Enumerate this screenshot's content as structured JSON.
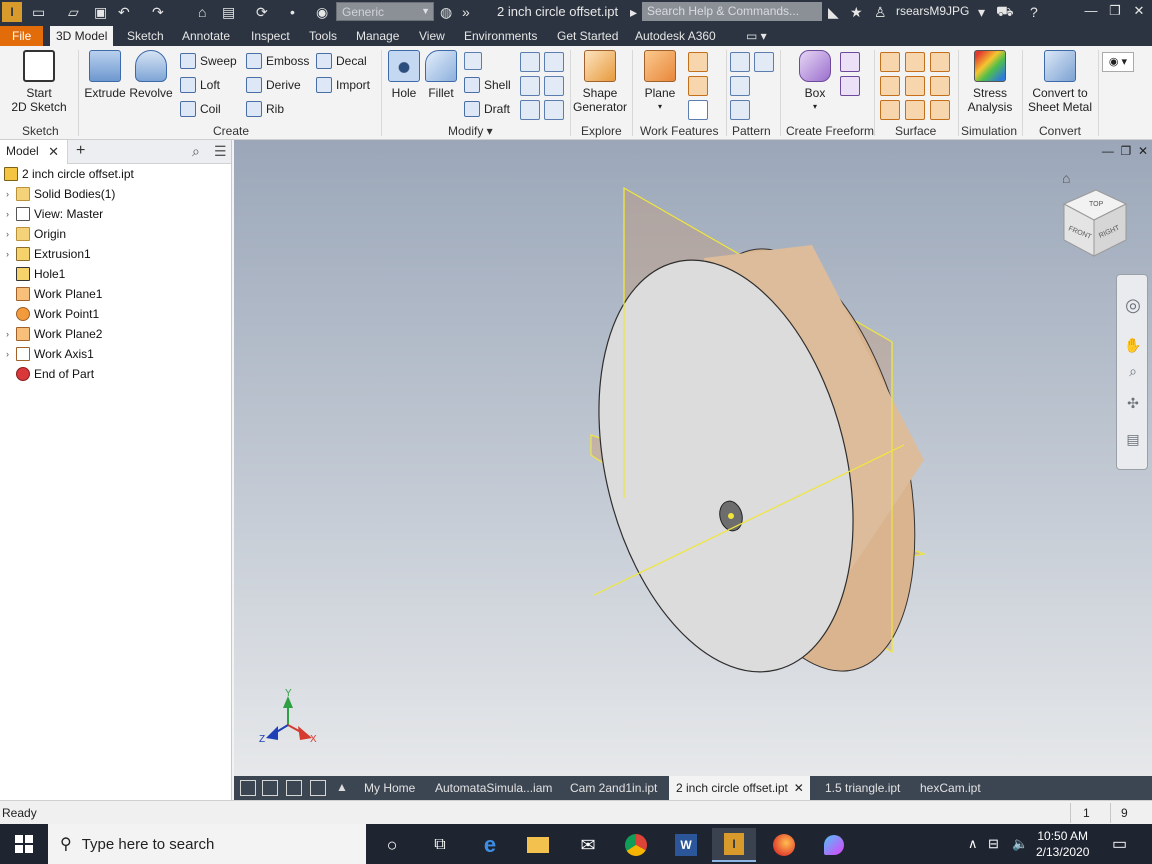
{
  "titlebar": {
    "material": "Generic",
    "document_title": "2 inch circle offset.ipt",
    "search_placeholder": "Search Help & Commands...",
    "user": "rsearsM9JPG"
  },
  "ribbon_tabs": [
    "File",
    "3D Model",
    "Sketch",
    "Annotate",
    "Inspect",
    "Tools",
    "Manage",
    "View",
    "Environments",
    "Get Started",
    "Autodesk A360"
  ],
  "active_tab": "3D Model",
  "ribbon": {
    "sketch": {
      "start_line1": "Start",
      "start_line2": "2D Sketch",
      "label": "Sketch"
    },
    "create": {
      "extrude": "Extrude",
      "revolve": "Revolve",
      "sweep": "Sweep",
      "loft": "Loft",
      "coil": "Coil",
      "emboss": "Emboss",
      "derive": "Derive",
      "rib": "Rib",
      "decal": "Decal",
      "import": "Import",
      "label": "Create"
    },
    "modify": {
      "hole": "Hole",
      "fillet": "Fillet",
      "shell": "Shell",
      "draft": "Draft",
      "label": "Modify"
    },
    "explore": {
      "shape_line1": "Shape",
      "shape_line2": "Generator",
      "label": "Explore"
    },
    "work_features": {
      "plane": "Plane",
      "label": "Work Features"
    },
    "pattern": {
      "label": "Pattern"
    },
    "freeform": {
      "box": "Box",
      "label": "Create Freeform"
    },
    "surface": {
      "label": "Surface"
    },
    "simulation": {
      "stress_line1": "Stress",
      "stress_line2": "Analysis",
      "label": "Simulation"
    },
    "convert": {
      "convert_line1": "Convert to",
      "convert_line2": "Sheet Metal",
      "label": "Convert"
    }
  },
  "browser": {
    "tab": "Model",
    "tree": [
      {
        "label": "2 inch circle offset.ipt",
        "icon": "part-icon",
        "expander": false
      },
      {
        "label": "Solid Bodies(1)",
        "icon": "solid-bodies-icon",
        "expander": true
      },
      {
        "label": "View: Master",
        "icon": "view-icon",
        "expander": true
      },
      {
        "label": "Origin",
        "icon": "folder-icon",
        "expander": true
      },
      {
        "label": "Extrusion1",
        "icon": "extrusion-icon",
        "expander": true
      },
      {
        "label": "Hole1",
        "icon": "hole-icon",
        "expander": false
      },
      {
        "label": "Work Plane1",
        "icon": "work-plane-icon",
        "expander": false
      },
      {
        "label": "Work Point1",
        "icon": "work-point-icon",
        "expander": false
      },
      {
        "label": "Work Plane2",
        "icon": "work-plane-icon",
        "expander": true
      },
      {
        "label": "Work Axis1",
        "icon": "work-axis-icon",
        "expander": true
      },
      {
        "label": "End of Part",
        "icon": "end-of-part-icon",
        "expander": false
      }
    ]
  },
  "viewcube": {
    "top": "TOP",
    "front": "FRONT",
    "right": "RIGHT"
  },
  "axes": {
    "x": "X",
    "y": "Y",
    "z": "Z"
  },
  "doc_tabs": [
    {
      "label": "My Home",
      "active": false
    },
    {
      "label": "AutomataSimula...iam",
      "active": false
    },
    {
      "label": "Cam 2and1in.ipt",
      "active": false
    },
    {
      "label": "2 inch circle offset.ipt",
      "active": true
    },
    {
      "label": "1.5 triangle.ipt",
      "active": false
    },
    {
      "label": "hexCam.ipt",
      "active": false
    }
  ],
  "status": {
    "text": "Ready",
    "num1": "1",
    "num2": "9"
  },
  "taskbar": {
    "search_placeholder": "Type here to search",
    "time": "10:50 AM",
    "date": "2/13/2020"
  },
  "colors": {
    "accent": "#e36c0a",
    "titlebar": "#2b3440",
    "selection": "#f0e63c"
  }
}
